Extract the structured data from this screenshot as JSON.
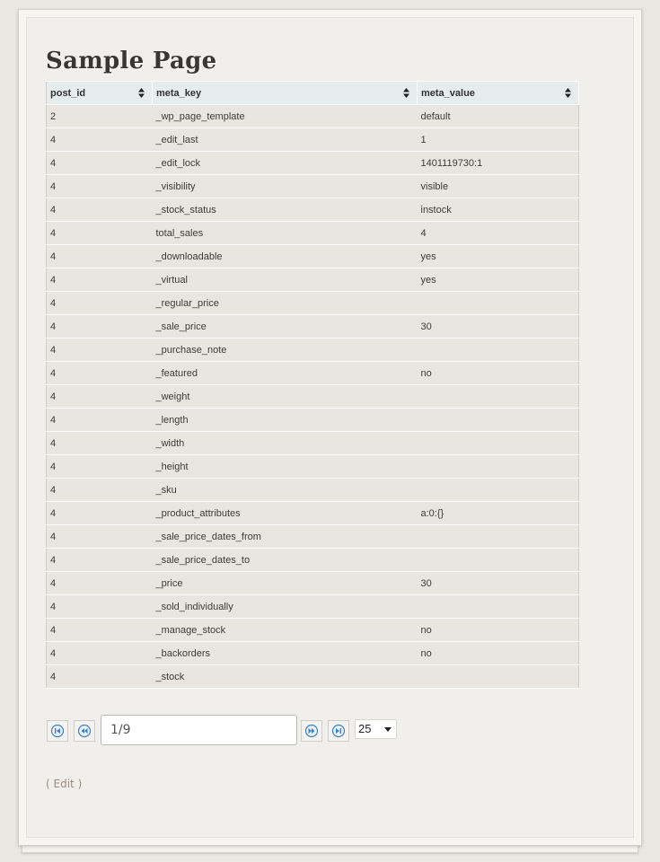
{
  "page": {
    "title": "Sample Page"
  },
  "table": {
    "columns": [
      "post_id",
      "meta_key",
      "meta_value"
    ],
    "rows": [
      [
        "2",
        "_wp_page_template",
        "default"
      ],
      [
        "4",
        "_edit_last",
        "1"
      ],
      [
        "4",
        "_edit_lock",
        "1401119730:1"
      ],
      [
        "4",
        "_visibility",
        "visible"
      ],
      [
        "4",
        "_stock_status",
        "instock"
      ],
      [
        "4",
        "total_sales",
        "4"
      ],
      [
        "4",
        "_downloadable",
        "yes"
      ],
      [
        "4",
        "_virtual",
        "yes"
      ],
      [
        "4",
        "_regular_price",
        ""
      ],
      [
        "4",
        "_sale_price",
        "30"
      ],
      [
        "4",
        "_purchase_note",
        ""
      ],
      [
        "4",
        "_featured",
        "no"
      ],
      [
        "4",
        "_weight",
        ""
      ],
      [
        "4",
        "_length",
        ""
      ],
      [
        "4",
        "_width",
        ""
      ],
      [
        "4",
        "_height",
        ""
      ],
      [
        "4",
        "_sku",
        ""
      ],
      [
        "4",
        "_product_attributes",
        "a:0:{}"
      ],
      [
        "4",
        "_sale_price_dates_from",
        ""
      ],
      [
        "4",
        "_sale_price_dates_to",
        ""
      ],
      [
        "4",
        "_price",
        "30"
      ],
      [
        "4",
        "_sold_individually",
        ""
      ],
      [
        "4",
        "_manage_stock",
        "no"
      ],
      [
        "4",
        "_backorders",
        "no"
      ],
      [
        "4",
        "_stock",
        ""
      ]
    ]
  },
  "pager": {
    "page_display": "1/9",
    "page_size": "25",
    "first_icon": "first-page-icon",
    "prev_icon": "prev-page-icon",
    "next_icon": "next-page-icon",
    "last_icon": "last-page-icon",
    "sort_icon": "sort-arrows-icon"
  },
  "edit": {
    "open": "(",
    "label": "Edit",
    "close": ")"
  },
  "colors": {
    "icon_blue": "#3f7fc4",
    "link": "#9a8c7c",
    "header_bg": "#e7ecec",
    "row_bg": "#e9e6e2"
  }
}
